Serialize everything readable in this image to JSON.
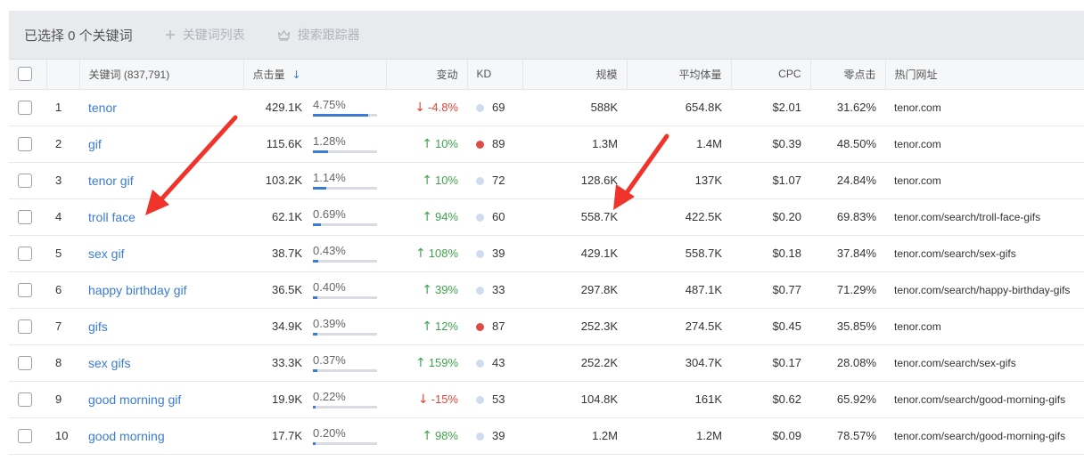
{
  "toolbar": {
    "selected_label": "已选择 0 个关键词",
    "keyword_list_label": "关键词列表",
    "tracker_label": "搜索跟踪器"
  },
  "columns": {
    "keyword": "关键词 (837,791)",
    "clicks": "点击量",
    "change": "变动",
    "kd": "KD",
    "scale": "规模",
    "avg_volume": "平均体量",
    "cpc": "CPC",
    "zero_click": "零点击",
    "top_url": "热门网址"
  },
  "colors": {
    "kd_low": "#cfdcf0",
    "kd_high": "#dd4b45",
    "up": "#3fa34d",
    "down": "#e0453a",
    "link": "#3a7bd5",
    "annotation_arrow": "#f0342b"
  },
  "rows": [
    {
      "idx": "1",
      "keyword": "tenor",
      "clicks": "429.1K",
      "share": "4.75%",
      "share_value": 4.75,
      "change": "-4.8%",
      "dir": "down",
      "kd": "69",
      "kd_level": "low",
      "scale": "588K",
      "avg": "654.8K",
      "cpc": "$2.01",
      "zero": "31.62%",
      "url": "tenor.com"
    },
    {
      "idx": "2",
      "keyword": "gif",
      "clicks": "115.6K",
      "share": "1.28%",
      "share_value": 1.28,
      "change": "10%",
      "dir": "up",
      "kd": "89",
      "kd_level": "high",
      "scale": "1.3M",
      "avg": "1.4M",
      "cpc": "$0.39",
      "zero": "48.50%",
      "url": "tenor.com"
    },
    {
      "idx": "3",
      "keyword": "tenor gif",
      "clicks": "103.2K",
      "share": "1.14%",
      "share_value": 1.14,
      "change": "10%",
      "dir": "up",
      "kd": "72",
      "kd_level": "low",
      "scale": "128.6K",
      "avg": "137K",
      "cpc": "$1.07",
      "zero": "24.84%",
      "url": "tenor.com"
    },
    {
      "idx": "4",
      "keyword": "troll face",
      "clicks": "62.1K",
      "share": "0.69%",
      "share_value": 0.69,
      "change": "94%",
      "dir": "up",
      "kd": "60",
      "kd_level": "low",
      "scale": "558.7K",
      "avg": "422.5K",
      "cpc": "$0.20",
      "zero": "69.83%",
      "url": "tenor.com/search/troll-face-gifs"
    },
    {
      "idx": "5",
      "keyword": "sex gif",
      "clicks": "38.7K",
      "share": "0.43%",
      "share_value": 0.43,
      "change": "108%",
      "dir": "up",
      "kd": "39",
      "kd_level": "low",
      "scale": "429.1K",
      "avg": "558.7K",
      "cpc": "$0.18",
      "zero": "37.84%",
      "url": "tenor.com/search/sex-gifs"
    },
    {
      "idx": "6",
      "keyword": "happy birthday gif",
      "clicks": "36.5K",
      "share": "0.40%",
      "share_value": 0.4,
      "change": "39%",
      "dir": "up",
      "kd": "33",
      "kd_level": "low",
      "scale": "297.8K",
      "avg": "487.1K",
      "cpc": "$0.77",
      "zero": "71.29%",
      "url": "tenor.com/search/happy-birthday-gifs"
    },
    {
      "idx": "7",
      "keyword": "gifs",
      "clicks": "34.9K",
      "share": "0.39%",
      "share_value": 0.39,
      "change": "12%",
      "dir": "up",
      "kd": "87",
      "kd_level": "high",
      "scale": "252.3K",
      "avg": "274.5K",
      "cpc": "$0.45",
      "zero": "35.85%",
      "url": "tenor.com"
    },
    {
      "idx": "8",
      "keyword": "sex gifs",
      "clicks": "33.3K",
      "share": "0.37%",
      "share_value": 0.37,
      "change": "159%",
      "dir": "up",
      "kd": "43",
      "kd_level": "low",
      "scale": "252.2K",
      "avg": "304.7K",
      "cpc": "$0.17",
      "zero": "28.08%",
      "url": "tenor.com/search/sex-gifs"
    },
    {
      "idx": "9",
      "keyword": "good morning gif",
      "clicks": "19.9K",
      "share": "0.22%",
      "share_value": 0.22,
      "change": "-15%",
      "dir": "down",
      "kd": "53",
      "kd_level": "low",
      "scale": "104.8K",
      "avg": "161K",
      "cpc": "$0.62",
      "zero": "65.92%",
      "url": "tenor.com/search/good-morning-gifs"
    },
    {
      "idx": "10",
      "keyword": "good morning",
      "clicks": "17.7K",
      "share": "0.20%",
      "share_value": 0.2,
      "change": "98%",
      "dir": "up",
      "kd": "39",
      "kd_level": "low",
      "scale": "1.2M",
      "avg": "1.2M",
      "cpc": "$0.09",
      "zero": "78.57%",
      "url": "tenor.com/search/good-morning-gifs"
    }
  ]
}
